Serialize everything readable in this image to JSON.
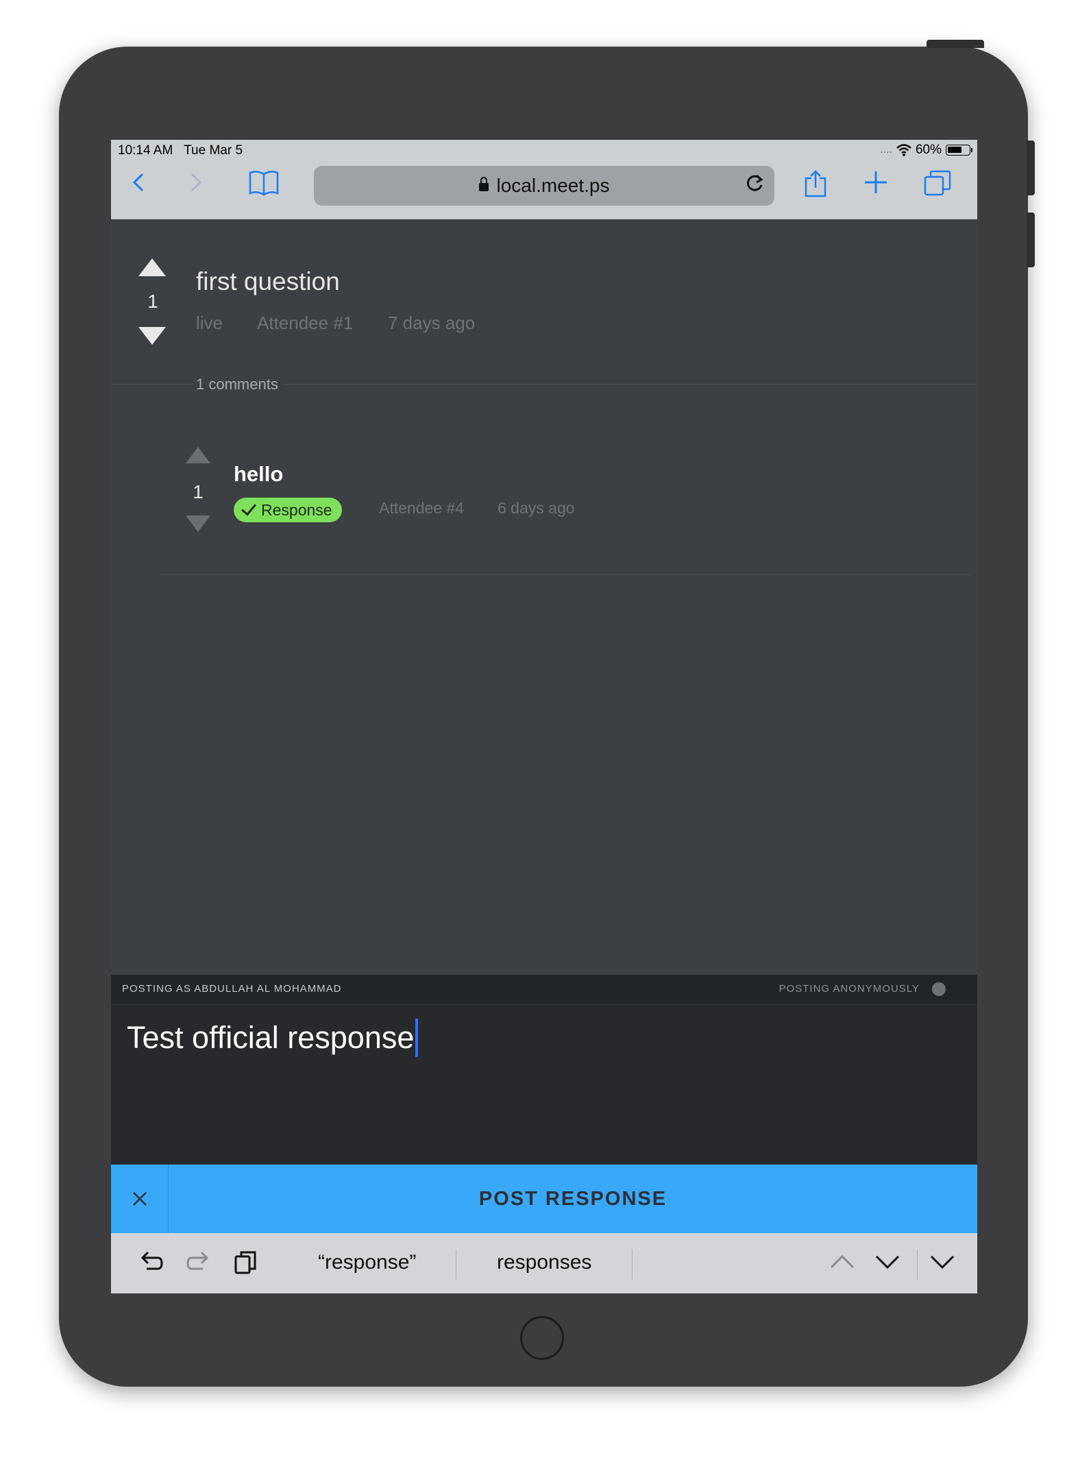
{
  "status_bar": {
    "time": "10:14 AM",
    "date": "Tue Mar 5",
    "signal": "....",
    "battery": "60%"
  },
  "browser": {
    "url": "local.meet.ps",
    "icons": [
      "back-icon",
      "forward-icon",
      "bookmarks-icon",
      "lock-icon",
      "reload-icon",
      "share-icon",
      "new-tab-icon",
      "tabs-icon"
    ]
  },
  "question": {
    "title": "first question",
    "votes": "1",
    "status": "live",
    "author": "Attendee #1",
    "time": "7 days ago",
    "comments_label": "1 comments"
  },
  "comment": {
    "title": "hello",
    "votes": "1",
    "badge": "Response",
    "author": "Attendee #4",
    "time": "6 days ago",
    "badge_color": "#7ee05a"
  },
  "composer": {
    "posting_as": "POSTING AS ABDULLAH AL MOHAMMAD",
    "posting_anonymously": "POSTING ANONYMOUSLY",
    "text": "Test official response",
    "post_button": "POST RESPONSE",
    "accent_color": "#3aa8f8"
  },
  "keyboard": {
    "suggestions": [
      "“response”",
      "responses"
    ]
  }
}
